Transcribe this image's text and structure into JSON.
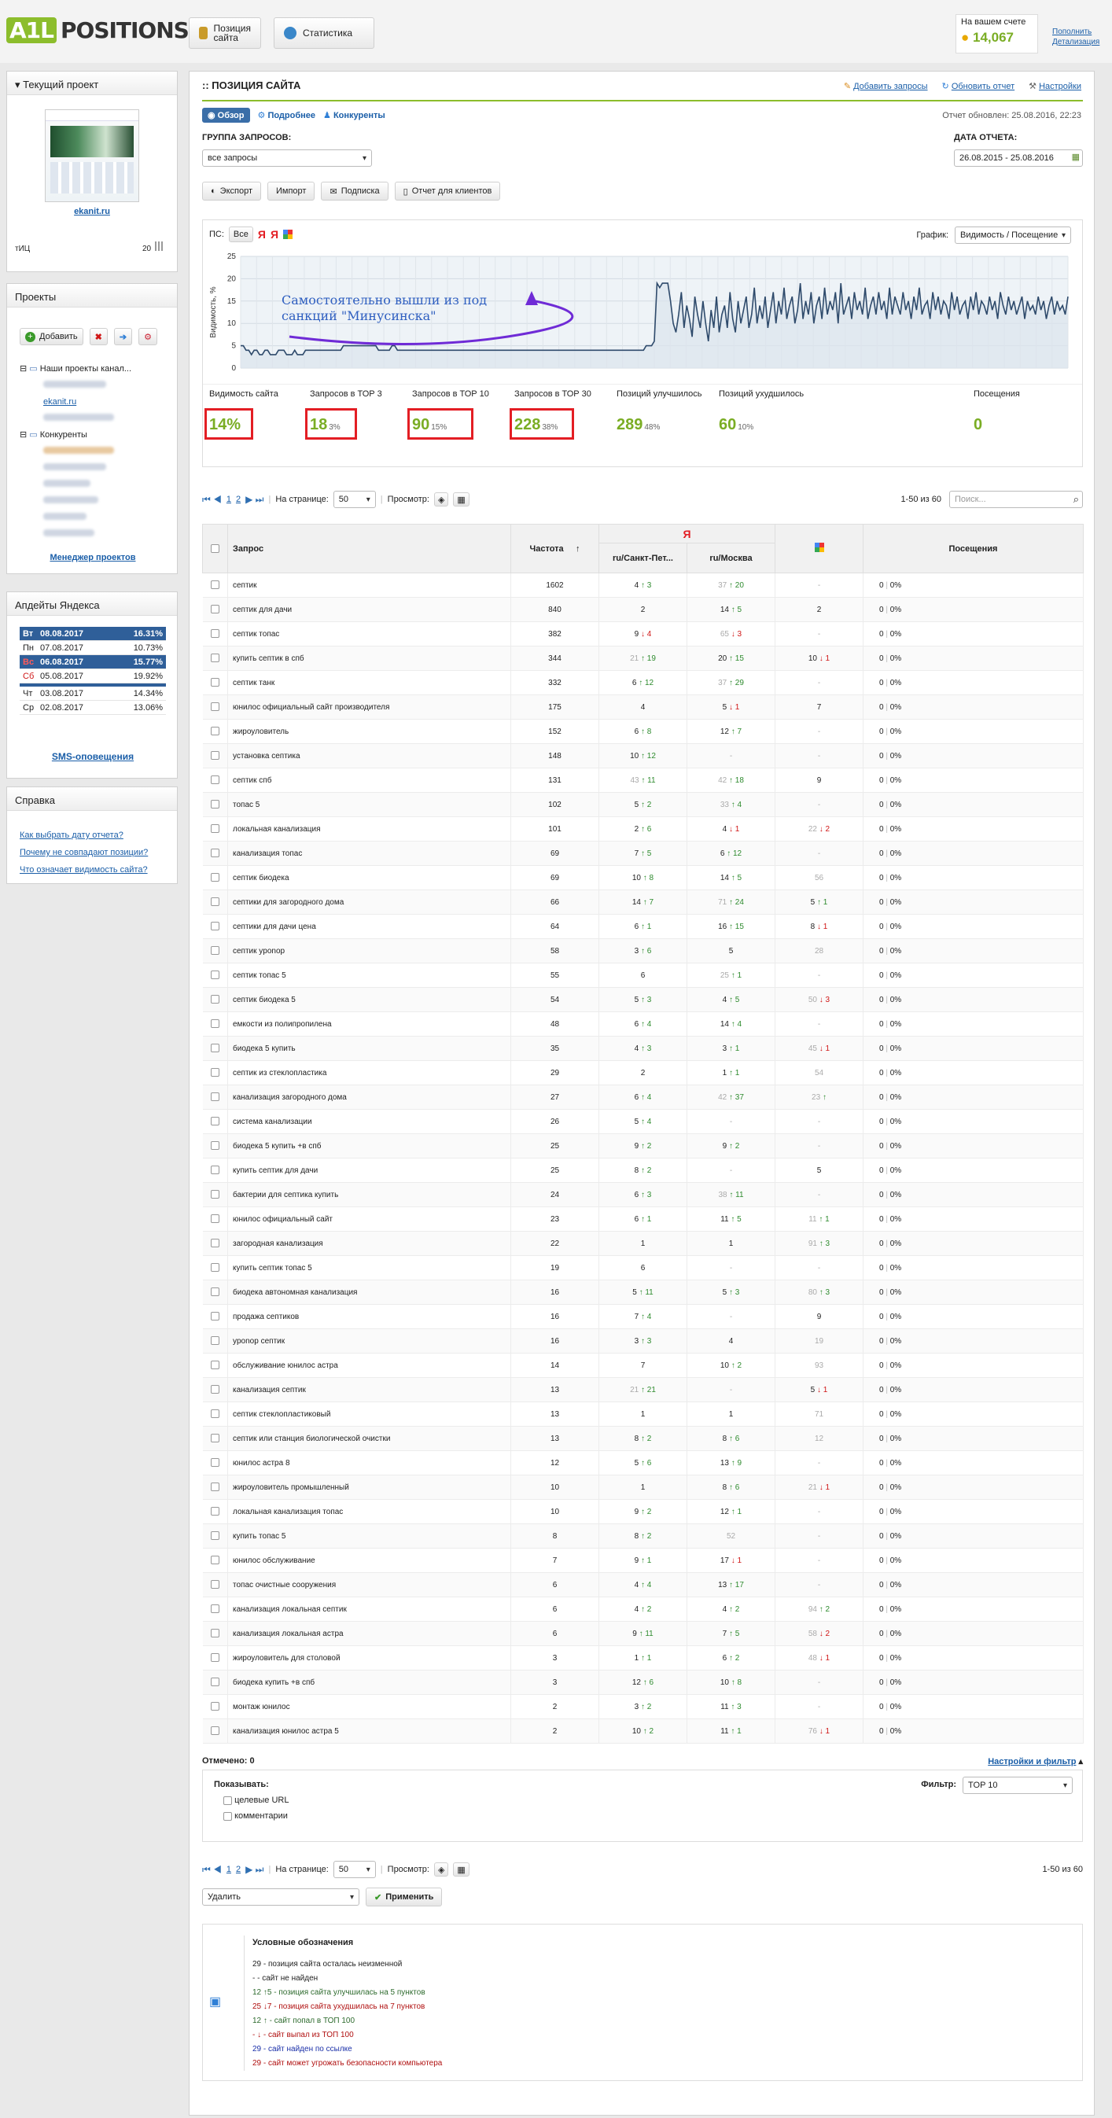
{
  "header": {
    "logo_a": "A1L",
    "logo_b": "POSITIONS",
    "tab_positions": "Позиция сайта",
    "tab_stats": "Статистика",
    "balance_label": "На вашем счете",
    "balance_amount": "14,067",
    "link_topup": "Пополнить",
    "link_details": "Детализация"
  },
  "sidebar": {
    "project_title": "Текущий проект",
    "site": "ekanit.ru",
    "tic_label": "тИЦ",
    "tic_value": "20",
    "projects_title": "Проекты",
    "add_label": "Добавить",
    "tree_root": "Наши проекты канал...",
    "tree_site": "ekanit.ru",
    "tree_competitors": "Конкуренты",
    "manager_link": "Менеджер проектов",
    "updates_title": "Апдейты Яндекса",
    "updates": [
      [
        "Вт",
        "08.08.2017",
        "16.31%"
      ],
      [
        "Пн",
        "07.08.2017",
        "10.73%"
      ],
      [
        "Вс",
        "06.08.2017",
        "15.77%"
      ],
      [
        "Сб",
        "05.08.2017",
        "19.92%"
      ],
      [
        "Чт",
        "03.08.2017",
        "14.34%"
      ],
      [
        "Ср",
        "02.08.2017",
        "13.06%"
      ]
    ],
    "sms_link": "SMS-оповещения",
    "help_title": "Справка",
    "help_links": [
      "Как выбрать дату отчета?",
      "Почему не совпадают позиции?",
      "Что означает видимость сайта?"
    ]
  },
  "main": {
    "title": "ПОЗИЦИЯ САЙТА",
    "link_add": "Добавить запросы",
    "link_refresh": "Обновить отчет",
    "link_settings": "Настройки",
    "report_updated": "Отчет обновлен: 25.08.2016, 22:23",
    "view_overview": "Обзор",
    "view_detail": "Подробнее",
    "view_competitors": "Конкуренты",
    "group_label": "ГРУППА ЗАПРОСОВ:",
    "group_value": "все запросы",
    "date_label": "ДАТА ОТЧЕТА:",
    "date_value": "26.08.2015 - 25.08.2016",
    "btn_export": "Экспорт",
    "btn_import": "Импорт",
    "btn_subscribe": "Подписка",
    "btn_client": "Отчет для клиентов",
    "ps_label": "ПС:",
    "ps_all": "Все",
    "graph_label": "График:",
    "graph_value": "Видимость / Посещение",
    "annotation": "Самостоятельно вышли из под санкций \"Минусинска\""
  },
  "chart_data": {
    "type": "line",
    "ylabel": "Видимость, %",
    "ylim": [
      0,
      25
    ],
    "yticks": [
      0,
      5,
      10,
      15,
      20,
      25
    ],
    "values": [
      5,
      5,
      4,
      4,
      3,
      4,
      4,
      3,
      3,
      4,
      4,
      3,
      3,
      3,
      4,
      4,
      4,
      3,
      3,
      3,
      4,
      3,
      3,
      3,
      4,
      4,
      4,
      4,
      4,
      4,
      4,
      4,
      4,
      4,
      4,
      4,
      4,
      4,
      5,
      5,
      5,
      5,
      5,
      5,
      5,
      5,
      5,
      5,
      5,
      5,
      5,
      4,
      4,
      4,
      4,
      4,
      5,
      5,
      4,
      4,
      4,
      4,
      4,
      4,
      4,
      4,
      4,
      4,
      4,
      4,
      4,
      4,
      4,
      4,
      4,
      4,
      4,
      4,
      4,
      4,
      4,
      4,
      4,
      4,
      4,
      4,
      4,
      4,
      4,
      4,
      4,
      4,
      4,
      4,
      4,
      4,
      4,
      4,
      4,
      4,
      4,
      4,
      4,
      4,
      4,
      4,
      4,
      4,
      4,
      4,
      4,
      4,
      4,
      4,
      4,
      4,
      4,
      4,
      4,
      4,
      4,
      4,
      4,
      4,
      4,
      4,
      4,
      4,
      4,
      4,
      4,
      4,
      4,
      4,
      4,
      4,
      4,
      4,
      4,
      4,
      4,
      4,
      4,
      4,
      4,
      4,
      4,
      4,
      4,
      4,
      5,
      5,
      5,
      6,
      19,
      18,
      19,
      19,
      19,
      15,
      10,
      8,
      12,
      17,
      9,
      14,
      11,
      7,
      16,
      12,
      9,
      15,
      10,
      6,
      13,
      9,
      16,
      8,
      12,
      14,
      9,
      17,
      11,
      8,
      15,
      10,
      13,
      16,
      9,
      12,
      18,
      10,
      14,
      11,
      16,
      9,
      13,
      17,
      10,
      15,
      12,
      18,
      11,
      14,
      16,
      10,
      13,
      19,
      11,
      15,
      12,
      17,
      10,
      14,
      16,
      11,
      18,
      12,
      15,
      13,
      17,
      10,
      19,
      12,
      14,
      16,
      11,
      17,
      13,
      15,
      12,
      18,
      11,
      14,
      16,
      12,
      17,
      13,
      15,
      11,
      18,
      12,
      16,
      14,
      12,
      17,
      13,
      15,
      11,
      16,
      13,
      18,
      12,
      14,
      15,
      11,
      17,
      13,
      16,
      12,
      15,
      14,
      11,
      17,
      13,
      16,
      12,
      14,
      15,
      11,
      16,
      13,
      17,
      12,
      15,
      14,
      12,
      16,
      13,
      15,
      11,
      17,
      14,
      12,
      16,
      13,
      15,
      12,
      14,
      16,
      11,
      15,
      13,
      14,
      12,
      16,
      13,
      15,
      11,
      14,
      16,
      12,
      15,
      13,
      14,
      12,
      16
    ]
  },
  "stats": [
    {
      "label": "Видимость сайта",
      "value": "14%",
      "sub": ""
    },
    {
      "label": "Запросов в ТОР 3",
      "value": "18",
      "sub": "3%"
    },
    {
      "label": "Запросов в ТОР 10",
      "value": "90",
      "sub": "15%"
    },
    {
      "label": "Запросов в ТОР 30",
      "value": "228",
      "sub": "38%"
    },
    {
      "label": "Позиций улучшилось",
      "value": "289",
      "sub": "48%"
    },
    {
      "label": "Позиций ухудшилось",
      "value": "60",
      "sub": "10%"
    },
    {
      "label": "Посещения",
      "value": "0",
      "sub": ""
    }
  ],
  "pager": {
    "per_page_label": "На странице:",
    "per_page": "50",
    "view_label": "Просмотр:",
    "range": "1-50 из 60",
    "range_bottom": "1-50 из 60",
    "search_placeholder": "Поиск..."
  },
  "table": {
    "h_query": "Запрос",
    "h_freq": "Частота",
    "h_spb": "ru/Санкт-Пет...",
    "h_msk": "ru/Москва",
    "h_visits": "Посещения",
    "rows": [
      [
        "септик",
        "1602",
        "4 ↑ 3",
        "37 ↑ 20",
        "-",
        "0 | 0%"
      ],
      [
        "септик для дачи",
        "840",
        "2",
        "14 ↑ 5",
        "2",
        "0 | 0%"
      ],
      [
        "септик топас",
        "382",
        "9 ↓ 4",
        "65 ↓ 3",
        "-",
        "0 | 0%"
      ],
      [
        "купить септик в спб",
        "344",
        "21 ↑ 19",
        "20 ↑ 15",
        "10 ↓ 1",
        "0 | 0%"
      ],
      [
        "септик танк",
        "332",
        "6 ↑ 12",
        "37 ↑ 29",
        "-",
        "0 | 0%"
      ],
      [
        "юнилос официальный сайт производителя",
        "175",
        "4",
        "5 ↓ 1",
        "7",
        "0 | 0%"
      ],
      [
        "жироуловитель",
        "152",
        "6 ↑ 8",
        "12 ↑ 7",
        "-",
        "0 | 0%"
      ],
      [
        "установка септика",
        "148",
        "10 ↑ 12",
        "-",
        "-",
        "0 | 0%"
      ],
      [
        "септик спб",
        "131",
        "43 ↑ 11",
        "42 ↑ 18",
        "9",
        "0 | 0%"
      ],
      [
        "топас 5",
        "102",
        "5 ↑ 2",
        "33 ↑ 4",
        "-",
        "0 | 0%"
      ],
      [
        "локальная канализация",
        "101",
        "2 ↑ 6",
        "4 ↓ 1",
        "22 ↓ 2",
        "0 | 0%"
      ],
      [
        "канализация топас",
        "69",
        "7 ↑ 5",
        "6 ↑ 12",
        "-",
        "0 | 0%"
      ],
      [
        "септик биодека",
        "69",
        "10 ↑ 8",
        "14 ↑ 5",
        "56",
        "0 | 0%"
      ],
      [
        "септики для загородного дома",
        "66",
        "14 ↑ 7",
        "71 ↑ 24",
        "5 ↑ 1",
        "0 | 0%"
      ],
      [
        "септики для дачи цена",
        "64",
        "6 ↑ 1",
        "16 ↑ 15",
        "8 ↓ 1",
        "0 | 0%"
      ],
      [
        "септик уponop",
        "58",
        "3 ↑ 6",
        "5",
        "28",
        "0 | 0%"
      ],
      [
        "септик топас 5",
        "55",
        "6",
        "25 ↑ 1",
        "-",
        "0 | 0%"
      ],
      [
        "септик биодека 5",
        "54",
        "5 ↑ 3",
        "4 ↑ 5",
        "50 ↓ 3",
        "0 | 0%"
      ],
      [
        "емкости из полипропилена",
        "48",
        "6 ↑ 4",
        "14 ↑ 4",
        "-",
        "0 | 0%"
      ],
      [
        "биодека 5 купить",
        "35",
        "4 ↑ 3",
        "3 ↑ 1",
        "45 ↓ 1",
        "0 | 0%"
      ],
      [
        "септик из стеклопластика",
        "29",
        "2",
        "1 ↑ 1",
        "54",
        "0 | 0%"
      ],
      [
        "канализация загородного дома",
        "27",
        "6 ↑ 4",
        "42 ↑ 37",
        "23 ↑",
        "0 | 0%"
      ],
      [
        "система канализации",
        "26",
        "5 ↑ 4",
        "-",
        "-",
        "0 | 0%"
      ],
      [
        "биодека 5 купить +в спб",
        "25",
        "9 ↑ 2",
        "9 ↑ 2",
        "-",
        "0 | 0%"
      ],
      [
        "купить септик для дачи",
        "25",
        "8 ↑ 2",
        "-",
        "5",
        "0 | 0%"
      ],
      [
        "бактерии для септика купить",
        "24",
        "6 ↑ 3",
        "38 ↑ 11",
        "-",
        "0 | 0%"
      ],
      [
        "юнилос официальный сайт",
        "23",
        "6 ↑ 1",
        "11 ↑ 5",
        "11 ↑ 1",
        "0 | 0%"
      ],
      [
        "загородная канализация",
        "22",
        "1",
        "1",
        "91 ↑ 3",
        "0 | 0%"
      ],
      [
        "купить септик топас 5",
        "19",
        "6",
        "-",
        "-",
        "0 | 0%"
      ],
      [
        "биодека автономная канализация",
        "16",
        "5 ↑ 11",
        "5 ↑ 3",
        "80 ↑ 3",
        "0 | 0%"
      ],
      [
        "продажа септиков",
        "16",
        "7 ↑ 4",
        "-",
        "9",
        "0 | 0%"
      ],
      [
        "уponop септик",
        "16",
        "3 ↑ 3",
        "4",
        "19",
        "0 | 0%"
      ],
      [
        "обслуживание юнилос астра",
        "14",
        "7",
        "10 ↑ 2",
        "93",
        "0 | 0%"
      ],
      [
        "канализация септик",
        "13",
        "21 ↑ 21",
        "-",
        "5 ↓ 1",
        "0 | 0%"
      ],
      [
        "септик стеклопластиковый",
        "13",
        "1",
        "1",
        "71",
        "0 | 0%"
      ],
      [
        "септик или станция биологической очистки",
        "13",
        "8 ↑ 2",
        "8 ↑ 6",
        "12",
        "0 | 0%"
      ],
      [
        "юнилос астра 8",
        "12",
        "5 ↑ 6",
        "13 ↑ 9",
        "-",
        "0 | 0%"
      ],
      [
        "жироуловитель промышленный",
        "10",
        "1",
        "8 ↑ 6",
        "21 ↓ 1",
        "0 | 0%"
      ],
      [
        "локальная канализация топас",
        "10",
        "9 ↑ 2",
        "12 ↑ 1",
        "-",
        "0 | 0%"
      ],
      [
        "купить топас 5",
        "8",
        "8 ↑ 2",
        "52",
        "-",
        "0 | 0%"
      ],
      [
        "юнилос обслуживание",
        "7",
        "9 ↑ 1",
        "17 ↓ 1",
        "-",
        "0 | 0%"
      ],
      [
        "топас очистные сооружения",
        "6",
        "4 ↑ 4",
        "13 ↑ 17",
        "-",
        "0 | 0%"
      ],
      [
        "канализация локальная септик",
        "6",
        "4 ↑ 2",
        "4 ↑ 2",
        "94 ↑ 2",
        "0 | 0%"
      ],
      [
        "канализация локальная астра",
        "6",
        "9 ↑ 11",
        "7 ↑ 5",
        "58 ↓ 2",
        "0 | 0%"
      ],
      [
        "жироуловитель для столовой",
        "3",
        "1 ↑ 1",
        "6 ↑ 2",
        "48 ↓ 1",
        "0 | 0%"
      ],
      [
        "биодека купить +в спб",
        "3",
        "12 ↑ 6",
        "10 ↑ 8",
        "-",
        "0 | 0%"
      ],
      [
        "монтаж юнилос",
        "2",
        "3 ↑ 2",
        "11 ↑ 3",
        "-",
        "0 | 0%"
      ],
      [
        "канализация юнилос астра 5",
        "2",
        "10 ↑ 2",
        "11 ↑ 1",
        "76 ↓ 1",
        "0 | 0%"
      ]
    ],
    "marked": "Отмечено: 0",
    "settings_filter": "Настройки и фильтр"
  },
  "filter": {
    "show_label": "Показывать:",
    "opt_urls": "целевые URL",
    "opt_comments": "комментарии",
    "filter_label": "Фильтр:",
    "filter_value": "TOP 10"
  },
  "actions": {
    "action_value": "Удалить",
    "apply": "Применить"
  },
  "legend": {
    "title": "Условные обозначения",
    "items": [
      "29 - позиция сайта осталась неизменной",
      "-  - сайт не найден",
      "12 ↑5 - позиция сайта улучшилась на 5 пунктов",
      "25 ↓7 - позиция сайта ухудшилась на 7 пунктов",
      "12 ↑ - сайт попал в ТОП 100",
      "- ↓ - сайт выпал из ТОП 100",
      "29 - сайт найден по ссылке",
      "29 - сайт может угрожать безопасности компьютера"
    ]
  }
}
